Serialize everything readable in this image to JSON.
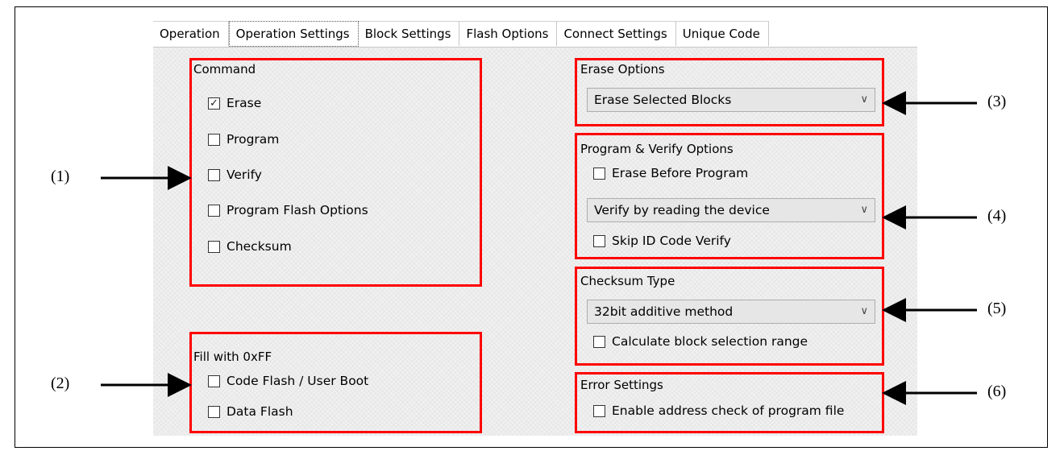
{
  "tabs": [
    "Operation",
    "Operation Settings",
    "Block Settings",
    "Flash Options",
    "Connect Settings",
    "Unique Code"
  ],
  "active_tab": "Operation Settings",
  "command": {
    "title": "Command",
    "items": [
      {
        "label": "Erase",
        "checked": true
      },
      {
        "label": "Program",
        "checked": false
      },
      {
        "label": "Verify",
        "checked": false
      },
      {
        "label": "Program Flash Options",
        "checked": false
      },
      {
        "label": "Checksum",
        "checked": false
      }
    ]
  },
  "fill": {
    "title": "Fill with 0xFF",
    "items": [
      {
        "label": "Code Flash / User Boot",
        "checked": false
      },
      {
        "label": "Data Flash",
        "checked": false
      }
    ]
  },
  "erase_options": {
    "title": "Erase Options",
    "selected": "Erase Selected Blocks"
  },
  "program_verify": {
    "title": "Program & Verify Options",
    "erase_before": "Erase Before Program",
    "verify_selected": "Verify by reading the device",
    "skip_id": "Skip ID Code Verify"
  },
  "checksum_type": {
    "title": "Checksum Type",
    "selected": "32bit additive method",
    "calc_range": "Calculate block selection range"
  },
  "error_settings": {
    "title": "Error Settings",
    "enable_check": "Enable address check of program file"
  },
  "callouts": [
    "(1)",
    "(2)",
    "(3)",
    "(4)",
    "(5)",
    "(6)"
  ],
  "icons": {
    "checkmark": "check-icon",
    "dropdown": "chevron-down-icon"
  },
  "colors": {
    "highlight": "#ff0000"
  }
}
